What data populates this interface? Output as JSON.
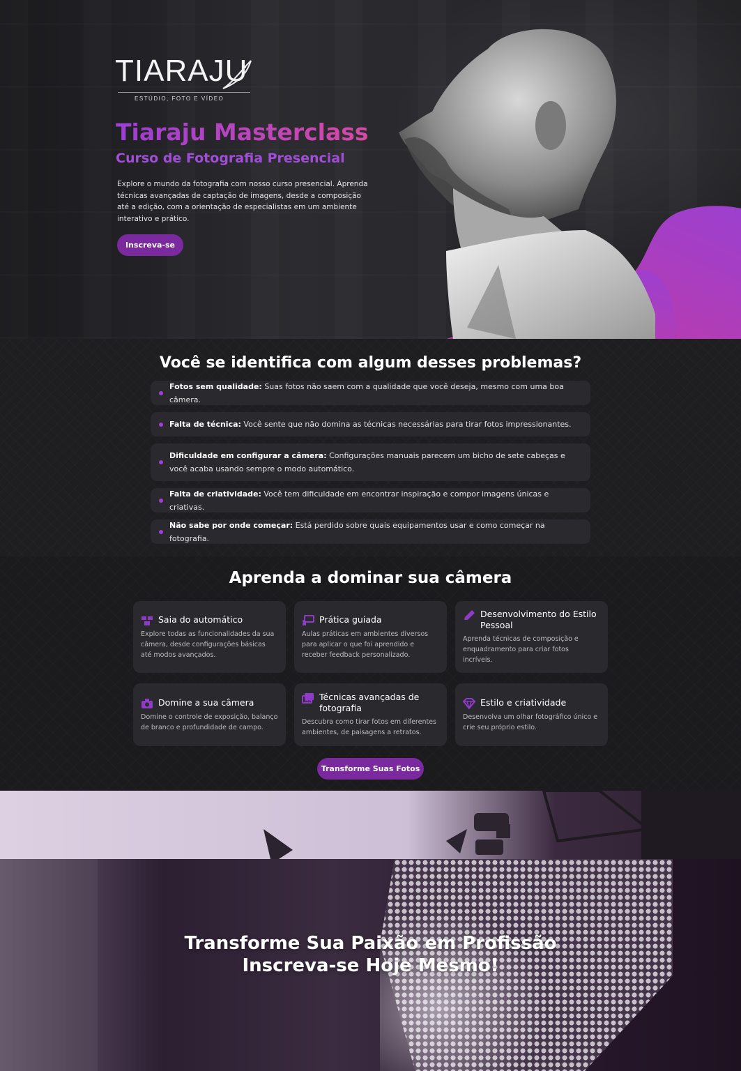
{
  "hero": {
    "logo_word": "TIARAJU",
    "logo_tagline": "ESTÚDIO, FOTO E VÍDEO",
    "title": "Tiaraju Masterclass",
    "subtitle": "Curso de Fotografia Presencial",
    "description": "Explore o mundo da fotografia com nosso curso presencial. Aprenda técnicas avançadas de captação de imagens, desde a composição até a edição, com a orientação de especialistas em um ambiente interativo e prático.",
    "cta_label": "Inscreva-se"
  },
  "problems": {
    "title": "Você se identifica com algum desses problemas?",
    "items": [
      {
        "bold": "Fotos sem qualidade:",
        "text": " Suas fotos não saem com a qualidade que você deseja, mesmo com uma boa câmera."
      },
      {
        "bold": "Falta de técnica:",
        "text": " Você sente que não domina as técnicas necessárias para tirar fotos impressionantes."
      },
      {
        "bold": "Dificuldade em configurar a câmera:",
        "text": " Configurações manuais parecem um bicho de sete cabeças e você acaba usando sempre o modo automático."
      },
      {
        "bold": "Falta de criatividade:",
        "text": " Você tem dificuldade em encontrar inspiração e compor imagens únicas e criativas."
      },
      {
        "bold": "Não sabe por onde começar:",
        "text": " Está perdido sobre quais equipamentos usar e como começar na fotografia."
      }
    ]
  },
  "learn": {
    "title": "Aprenda a dominar sua câmera",
    "cards": [
      {
        "icon": "boxes-icon",
        "title": "Saia do automático",
        "desc": "Explore todas as funcionalidades da sua câmera, desde configurações básicas até modos avançados."
      },
      {
        "icon": "presentation-icon",
        "title": "Prática guiada",
        "desc": "Aulas práticas em ambientes diversos para aplicar o que foi aprendido e receber feedback personalizado."
      },
      {
        "icon": "pencil-icon",
        "title": "Desenvolvimento do Estilo Pessoal",
        "desc": "Aprenda técnicas de composição e enquadramento para criar fotos incríveis."
      },
      {
        "icon": "camera-icon",
        "title": "Domine a sua câmera",
        "desc": "Domine o controle de exposição, balanço de branco e profundidade de campo."
      },
      {
        "icon": "images-icon",
        "title": "Técnicas avançadas de fotografia",
        "desc": "Descubra como tirar fotos em diferentes ambientes, de paisagens a retratos."
      },
      {
        "icon": "gem-icon",
        "title": "Estilo e criatividade",
        "desc": "Desenvolva um olhar fotográfico único e crie seu próprio estilo."
      }
    ],
    "cta_label": "Transforme Suas Fotos"
  },
  "cta": {
    "line1": "Transforme Sua Paixão em Profissão",
    "line2": "Inscreva-se Hoje Mesmo!"
  },
  "colors": {
    "accent": "#7a2a9e",
    "gradient_start": "#9b3fd4",
    "gradient_end": "#d64aa6"
  }
}
